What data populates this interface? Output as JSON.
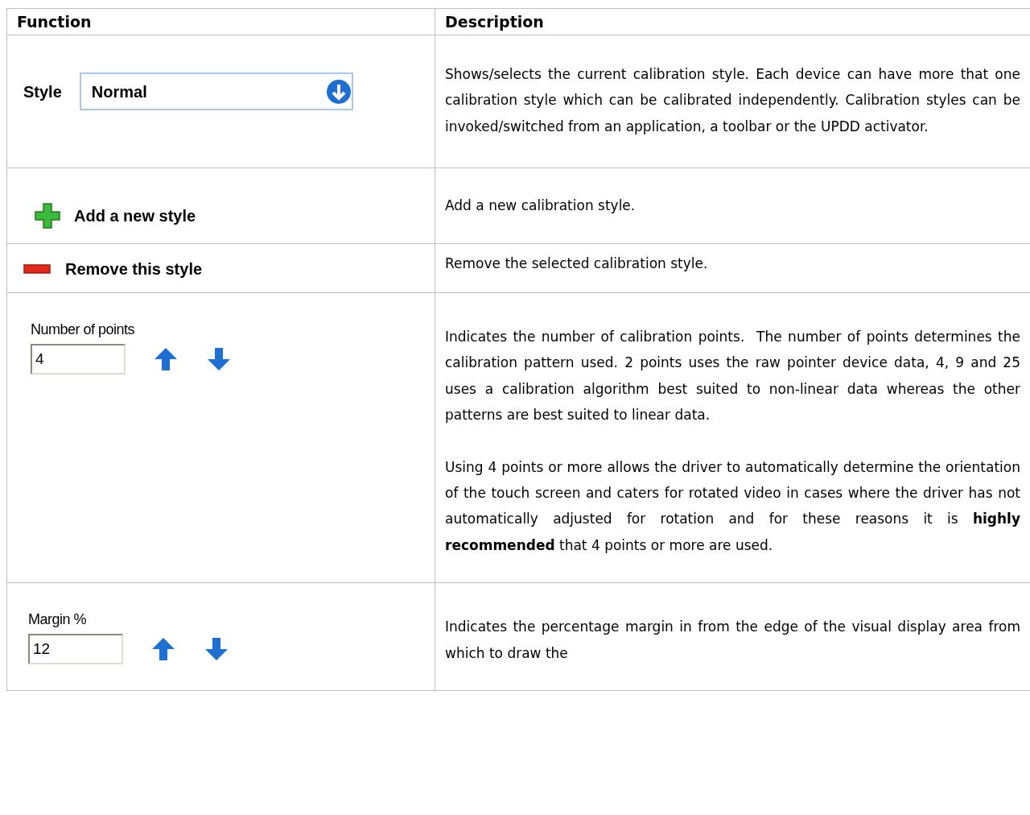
{
  "table": {
    "columns": [
      "Function",
      "Description"
    ],
    "rows": [
      {
        "kind": "dropdown",
        "control": {
          "label": "Style",
          "value": "Normal"
        },
        "description": [
          "Shows/selects the current calibration style. Each device can have more that one calibration style which can be calibrated independently. Calibration styles can be invoked/switched from an application, a toolbar or the UPDD activator."
        ]
      },
      {
        "kind": "add",
        "control": {
          "label": "Add a new style"
        },
        "description": [
          "Add a new calibration style."
        ]
      },
      {
        "kind": "remove",
        "control": {
          "label": "Remove this style"
        },
        "description": [
          "Remove the selected calibration style."
        ]
      },
      {
        "kind": "spinner",
        "control": {
          "label": "Number of points",
          "value": "4"
        },
        "description": [
          "Indicates the number of calibration points.  The number of points determines the calibration pattern used. 2 points uses the raw pointer device data, 4, 9 and 25 uses a calibration algorithm best suited to non-linear data whereas the other patterns are best suited to linear data.",
          "Using 4 points or more allows the driver to automatically determine the orientation of the touch screen and caters for rotated video in cases where the driver has not automatically adjusted for rotation and for these reasons it is **highly recommended** that 4 points or more are used."
        ]
      },
      {
        "kind": "spinner",
        "control": {
          "label": "Margin %",
          "value": "12"
        },
        "description": [
          "Indicates the percentage margin in from the edge of the visual display area from which to draw the"
        ]
      }
    ]
  }
}
